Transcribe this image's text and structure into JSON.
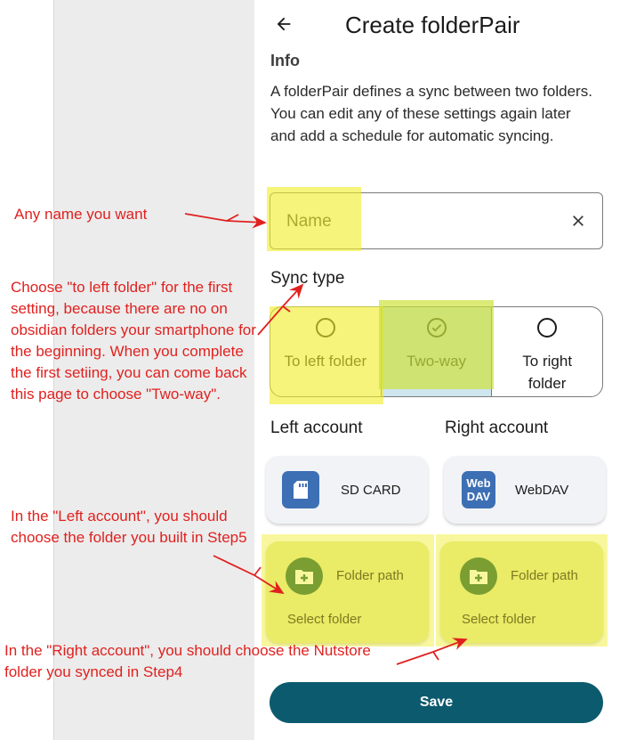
{
  "header": {
    "title": "Create folderPair",
    "back_icon": "arrow-back-icon"
  },
  "info": {
    "title": "Info",
    "text": "A folderPair defines a sync between two folders. You can edit any of these settings again later and add a schedule for automatic syncing."
  },
  "name_field": {
    "label": "Name",
    "clear_icon": "close-icon"
  },
  "sync_type": {
    "title": "Sync type",
    "options": [
      {
        "label": "To left folder",
        "selected": false
      },
      {
        "label": "Two-way",
        "selected": true
      },
      {
        "label": "To right folder",
        "selected": false
      }
    ]
  },
  "left_account": {
    "title": "Left account",
    "account_name": "SD CARD",
    "icon": "sd-card-icon",
    "folder_title": "Folder path",
    "folder_sub": "Select folder"
  },
  "right_account": {
    "title": "Right account",
    "account_name": "WebDAV",
    "icon_text": "Web DAV",
    "folder_title": "Folder path",
    "folder_sub": "Select folder"
  },
  "save_label": "Save",
  "annotations": {
    "name": "Any name you want",
    "sync": "Choose \"to left folder\" for the first setting, because there are no on obsidian folders your smartphone for the beginning. When you complete the first setiing, you can come back this page to choose \"Two-way\".",
    "left": "In the \"Left account\", you should choose the folder you built in Step5",
    "right": "In the \"Right account\", you should choose the Nutstore folder you synced in Step4"
  },
  "colors": {
    "primary": "#0c5a6e",
    "highlight": "#f0ee28",
    "annotation": "#e0211f",
    "folder_icon_bg": "#1b5e3a",
    "account_icon_bg": "#3d6fb4"
  }
}
